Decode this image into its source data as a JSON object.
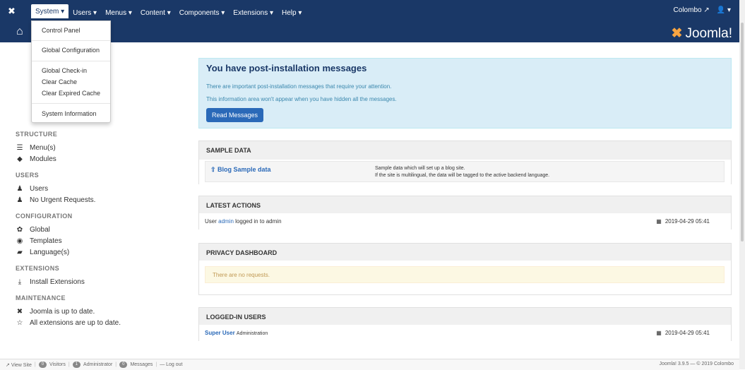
{
  "topnav": {
    "menus": [
      "System",
      "Users",
      "Menus",
      "Content",
      "Components",
      "Extensions",
      "Help"
    ],
    "user": "Colombo",
    "user_icon": "user-icon"
  },
  "dropdown": {
    "items": [
      "Control Panel",
      "Global Configuration",
      "Global Check-in",
      "Clear Cache",
      "Clear Expired Cache",
      "System Information"
    ]
  },
  "header": {
    "brand": "Joomla!"
  },
  "sidebar": {
    "sections": [
      {
        "title": "STRUCTURE",
        "items": [
          "Menu(s)",
          "Modules"
        ]
      },
      {
        "title": "USERS",
        "items": [
          "Users",
          "No Urgent Requests."
        ]
      },
      {
        "title": "CONFIGURATION",
        "items": [
          "Global",
          "Templates",
          "Language(s)"
        ]
      },
      {
        "title": "EXTENSIONS",
        "items": [
          "Install Extensions"
        ]
      },
      {
        "title": "MAINTENANCE",
        "items": [
          "Joomla is up to date.",
          "All extensions are up to date."
        ]
      }
    ]
  },
  "alert": {
    "title": "You have post-installation messages",
    "line1": "There are important post-installation messages that require your attention.",
    "line2": "This information area won't appear when you have hidden all the messages.",
    "button": "Read Messages"
  },
  "sample_data": {
    "title": "SAMPLE DATA",
    "link": "Blog Sample data",
    "desc1": "Sample data which will set up a blog site.",
    "desc2": "If the site is multilingual, the data will be tagged to the active backend language."
  },
  "latest_actions": {
    "title": "LATEST ACTIONS",
    "prefix": "User ",
    "user": "admin",
    "suffix": " logged in to admin",
    "date": "2019-04-29 05:41"
  },
  "privacy": {
    "title": "PRIVACY DASHBOARD",
    "message": "There are no requests."
  },
  "logged_in": {
    "title": "LOGGED-IN USERS",
    "user": "Super User",
    "role": "Administration",
    "date": "2019-04-29 05:41"
  },
  "footer": {
    "view_site": "View Site",
    "visitors_count": "0",
    "visitors": "Visitors",
    "admin_count": "1",
    "administrator": "Administrator",
    "messages_count": "0",
    "messages": "Messages",
    "logout": "Log out",
    "version": "Joomla! 3.9.5 — © 2019 Colombo"
  }
}
